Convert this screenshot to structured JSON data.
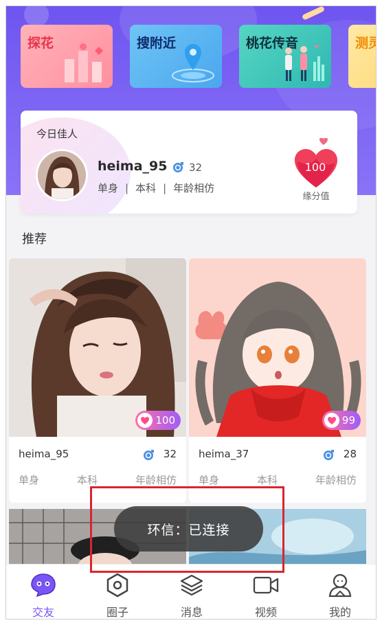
{
  "features": [
    {
      "label": "探花",
      "icon": "flowers-icon"
    },
    {
      "label": "搜附近",
      "icon": "location-pin-icon"
    },
    {
      "label": "桃花传音",
      "icon": "couple-icon"
    },
    {
      "label": "测灵",
      "icon": "test-icon"
    }
  ],
  "today": {
    "title": "今日佳人",
    "username": "heima_95",
    "gender": "male",
    "age": "32",
    "tags": [
      "单身",
      "本科",
      "年龄相仿"
    ],
    "score": "100",
    "score_label": "缘分值"
  },
  "section_title": "推荐",
  "recommend": [
    {
      "username": "heima_95",
      "age": "32",
      "gender": "male",
      "score": "100",
      "tags": [
        "单身",
        "本科",
        "年龄相仿"
      ]
    },
    {
      "username": "heima_37",
      "age": "28",
      "gender": "male",
      "score": "99",
      "tags": [
        "单身",
        "本科",
        "年龄相仿"
      ]
    }
  ],
  "toast": "环信：已连接",
  "tabs": [
    {
      "label": "交友",
      "icon": "chat-bubble-icon",
      "active": true
    },
    {
      "label": "圈子",
      "icon": "hexagon-icon",
      "active": false
    },
    {
      "label": "消息",
      "icon": "layers-icon",
      "active": false
    },
    {
      "label": "视频",
      "icon": "video-camera-icon",
      "active": false
    },
    {
      "label": "我的",
      "icon": "user-profile-icon",
      "active": false
    }
  ],
  "colors": {
    "primary": "#7a55f5",
    "header": "#6f55f0",
    "score_pill_start": "#ff6fa8",
    "score_pill_end": "#a15df5"
  }
}
